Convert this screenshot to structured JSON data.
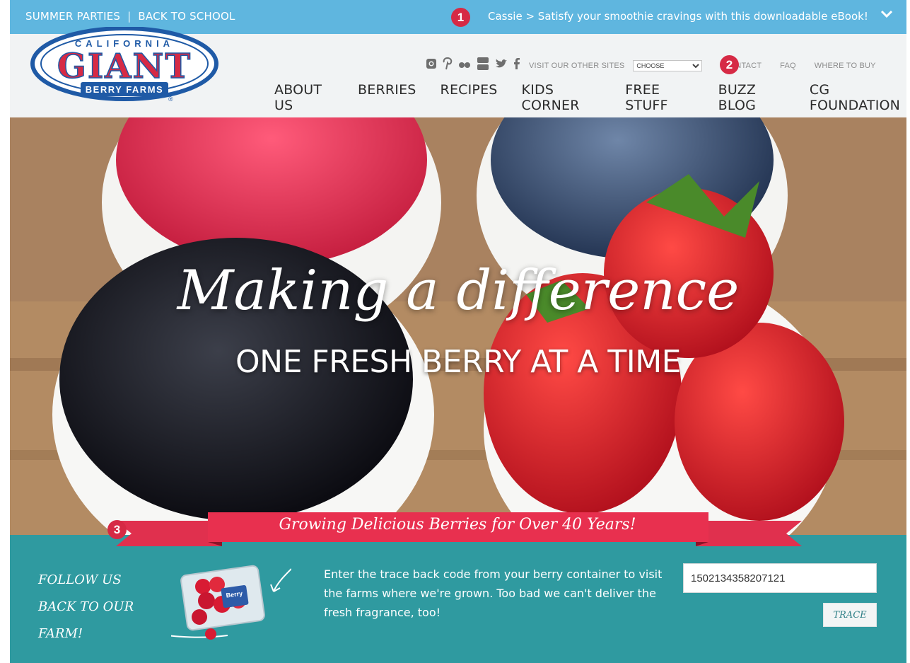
{
  "topbar": {
    "links": [
      "SUMMER PARTIES",
      "BACK TO SCHOOL"
    ],
    "separator": "|",
    "promo": "Cassie > Satisfy your smoothie cravings with this downloadable eBook!",
    "chevron_icon": "chevron-down-icon",
    "marker": "1"
  },
  "header": {
    "logo": {
      "top": "CALIFORNIA",
      "word": "GIANT",
      "bottom": "BERRY FARMS",
      "registered": "®"
    },
    "social_icons": [
      "instagram-icon",
      "pinterest-icon",
      "flickr-icon",
      "youtube-icon",
      "twitter-icon",
      "facebook-icon"
    ],
    "other_sites_label": "VISIT OUR OTHER SITES",
    "other_sites_selected": "CHOOSE",
    "utility_links": [
      "CONTACT",
      "FAQ",
      "WHERE TO BUY"
    ],
    "marker": "2",
    "nav": [
      "ABOUT US",
      "BERRIES",
      "RECIPES",
      "KIDS CORNER",
      "FREE STUFF",
      "BUZZ BLOG",
      "CG FOUNDATION"
    ]
  },
  "hero": {
    "headline": "Making a difference",
    "subhead": "ONE FRESH BERRY AT A TIME"
  },
  "ribbon": {
    "text": "Growing Delicious Berries for Over 40 Years!",
    "marker": "3"
  },
  "traceback": {
    "follow_lines": [
      "FOLLOW US",
      "BACK TO OUR",
      "FARM!"
    ],
    "description": "Enter the trace back code from your berry container to visit the farms where we're grown. Too bad we can't deliver the fresh fragrance, too!",
    "input_value": "1502134358207121",
    "button_label": "TRACE",
    "package_label": "Berry"
  },
  "colors": {
    "topbar": "#5fb6df",
    "accent_red": "#d62a45",
    "logo_blue": "#1f5aa6",
    "band_teal": "#2f9aa0"
  }
}
